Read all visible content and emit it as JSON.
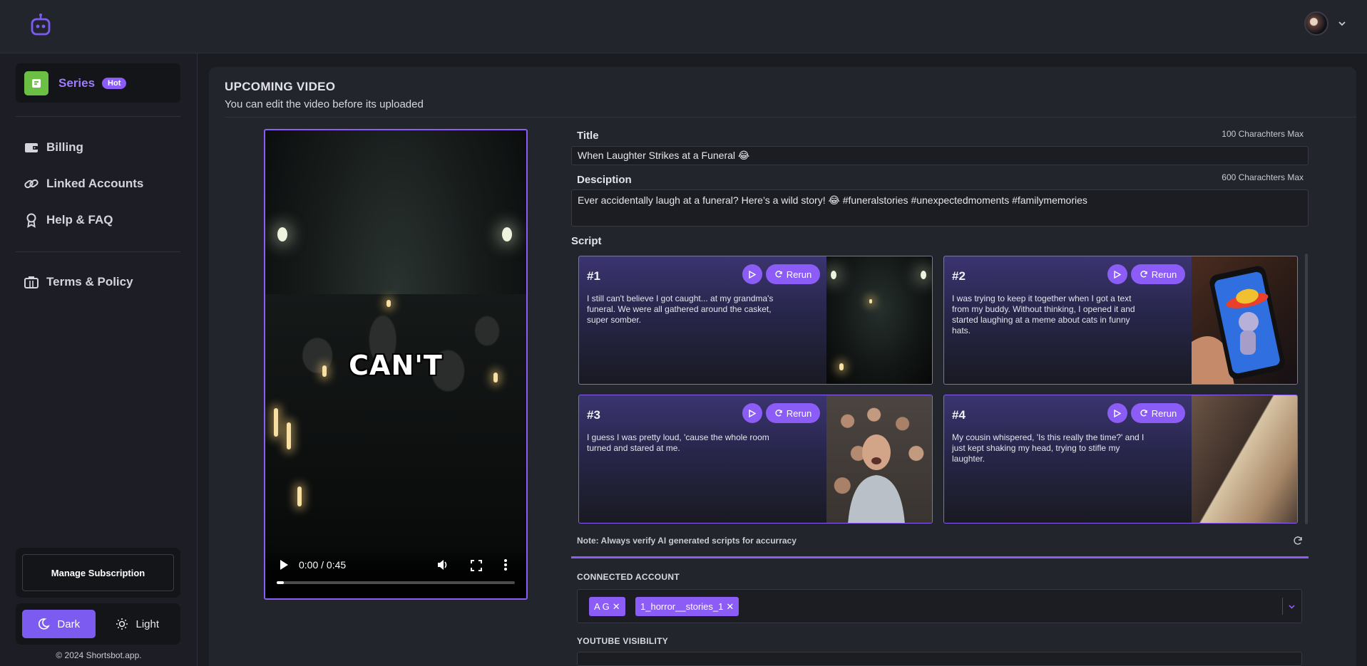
{
  "sidebar": {
    "series_label": "Series",
    "hot_badge": "Hot",
    "nav": {
      "billing": "Billing",
      "linked_accounts": "Linked Accounts",
      "help": "Help & FAQ",
      "terms": "Terms & Policy"
    },
    "manage_subscription": "Manage Subscription",
    "theme": {
      "dark": "Dark",
      "light": "Light",
      "selected": "Dark"
    },
    "copyright": "© 2024  Shortsbot.app."
  },
  "main": {
    "heading": "UPCOMING VIDEO",
    "subheading": "You can edit the video before its uploaded",
    "video": {
      "caption": "CAN'T",
      "time": "0:00 / 0:45",
      "progress": 0.03
    },
    "title_field": {
      "label": "Title",
      "max": "100 Charachters Max",
      "value": "When Laughter Strikes at a Funeral 😂"
    },
    "description_field": {
      "label": "Desciption",
      "max": "600 Charachters Max",
      "value": "Ever accidentally laugh at a funeral? Here’s a wild story! 😂 #funeralstories #unexpectedmoments #familymemories"
    },
    "script": {
      "label": "Script",
      "rerun_label": "Rerun",
      "scenes": [
        {
          "num": "#1",
          "text": "I still can't believe I got caught... at my grandma's funeral. We were all gathered around the casket, super somber."
        },
        {
          "num": "#2",
          "text": "I was trying to keep it together when I got a text from my buddy. Without thinking, I opened it and started laughing at a meme about cats in funny hats."
        },
        {
          "num": "#3",
          "text": "I guess I was pretty loud, 'cause the whole room turned and stared at me."
        },
        {
          "num": "#4",
          "text": "My cousin whispered, 'Is this really the time?' and I just kept shaking my head, trying to stifle my laughter."
        }
      ],
      "note": "Note: Always verify AI generated scripts for accurracy"
    },
    "connected_account": {
      "label": "CONNECTED ACCOUNT",
      "chips": [
        "A G",
        "1_horror__stories_1"
      ]
    },
    "youtube_visibility": {
      "label": "YOUTUBE VISIBILITY"
    }
  }
}
